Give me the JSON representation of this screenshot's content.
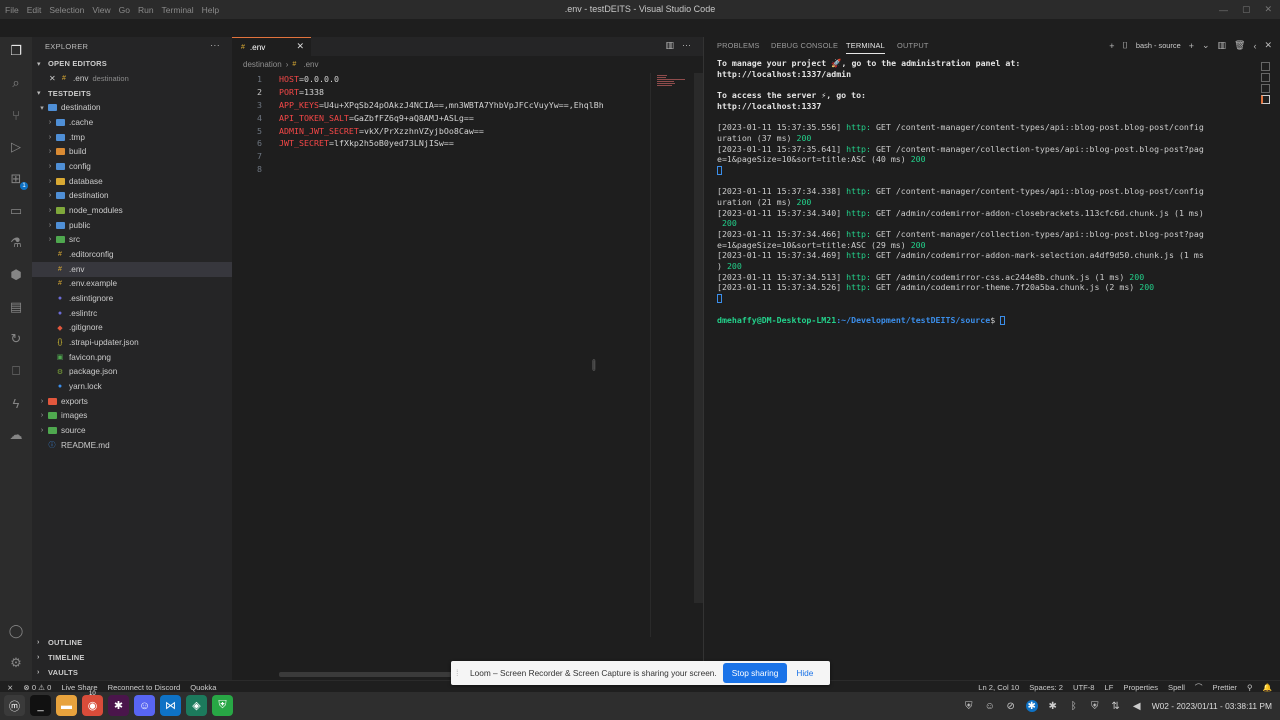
{
  "window": {
    "title": ".env - testDEITS - Visual Studio Code",
    "menu": [
      "File",
      "Edit",
      "Selection",
      "View",
      "Go",
      "Run",
      "Terminal",
      "Help"
    ]
  },
  "sidebar": {
    "header": "EXPLORER",
    "open_editors_label": "OPEN EDITORS",
    "open_editor": {
      "name": ".env",
      "folder": "destination"
    },
    "workspace_label": "TESTDEITS",
    "tree": [
      {
        "name": "destination",
        "depth": 1,
        "type": "folder",
        "open": true,
        "color": "#4f8fd6"
      },
      {
        "name": ".cache",
        "depth": 2,
        "type": "folder",
        "open": false,
        "color": "#4f8fd6"
      },
      {
        "name": ".tmp",
        "depth": 2,
        "type": "folder",
        "open": false,
        "color": "#4f8fd6"
      },
      {
        "name": "build",
        "depth": 2,
        "type": "folder",
        "open": false,
        "color": "#d98a33"
      },
      {
        "name": "config",
        "depth": 2,
        "type": "folder",
        "open": false,
        "color": "#4f8fd6"
      },
      {
        "name": "database",
        "depth": 2,
        "type": "folder",
        "open": false,
        "color": "#d9a933"
      },
      {
        "name": "destination",
        "depth": 2,
        "type": "folder",
        "open": false,
        "color": "#4f8fd6"
      },
      {
        "name": "node_modules",
        "depth": 2,
        "type": "folder",
        "open": false,
        "color": "#7fa83b"
      },
      {
        "name": "public",
        "depth": 2,
        "type": "folder",
        "open": false,
        "color": "#4f8fd6"
      },
      {
        "name": "src",
        "depth": 2,
        "type": "folder",
        "open": false,
        "color": "#4fa84f"
      },
      {
        "name": ".editorconfig",
        "depth": 2,
        "type": "file",
        "icon": "#",
        "color": "#d9a933"
      },
      {
        "name": ".env",
        "depth": 2,
        "type": "file",
        "icon": "#",
        "color": "#d9a933",
        "selected": true
      },
      {
        "name": ".env.example",
        "depth": 2,
        "type": "file",
        "icon": "#",
        "color": "#d9a933"
      },
      {
        "name": ".eslintignore",
        "depth": 2,
        "type": "file",
        "icon": "●",
        "color": "#6b6bd6"
      },
      {
        "name": ".eslintrc",
        "depth": 2,
        "type": "file",
        "icon": "●",
        "color": "#6b6bd6"
      },
      {
        "name": ".gitignore",
        "depth": 2,
        "type": "file",
        "icon": "◆",
        "color": "#e2573d"
      },
      {
        "name": ".strapi-updater.json",
        "depth": 2,
        "type": "file",
        "icon": "{}",
        "color": "#d9c433"
      },
      {
        "name": "favicon.png",
        "depth": 2,
        "type": "file",
        "icon": "▣",
        "color": "#4fa84f"
      },
      {
        "name": "package.json",
        "depth": 2,
        "type": "file",
        "icon": "⚙",
        "color": "#7fa83b"
      },
      {
        "name": "yarn.lock",
        "depth": 2,
        "type": "file",
        "icon": "●",
        "color": "#3b8eea"
      },
      {
        "name": "exports",
        "depth": 1,
        "type": "folder",
        "open": false,
        "color": "#e2573d"
      },
      {
        "name": "images",
        "depth": 1,
        "type": "folder",
        "open": false,
        "color": "#4fa84f"
      },
      {
        "name": "source",
        "depth": 1,
        "type": "folder",
        "open": false,
        "color": "#4fa84f"
      },
      {
        "name": "README.md",
        "depth": 1,
        "type": "file",
        "icon": "ⓘ",
        "color": "#3b8eea"
      }
    ],
    "outline_label": "OUTLINE",
    "timeline_label": "TIMELINE",
    "vaults_label": "VAULTS"
  },
  "editor": {
    "tab_label": ".env",
    "breadcrumb": [
      "destination",
      ".env"
    ],
    "current_line": 2,
    "lines": [
      {
        "key": "HOST",
        "value": "0.0.0.0"
      },
      {
        "key": "PORT",
        "value": "1338"
      },
      {
        "key": "APP_KEYS",
        "value": "U4u+XPqSb24pOAkzJ4NCIA==,mn3WBTA7YhbVpJFCcVuyYw==,EhqlBh"
      },
      {
        "key": "API_TOKEN_SALT",
        "value": "GaZbfFZ6q9+aQ8AMJ+ASLg=="
      },
      {
        "key": "ADMIN_JWT_SECRET",
        "value": "vkX/PrXzzhnVZyjbOo8Caw=="
      },
      {
        "key": "JWT_SECRET",
        "value": "lfXkp2h5oB0yed73LNjISw=="
      },
      {
        "key": "",
        "value": ""
      },
      {
        "key": "",
        "value": ""
      }
    ]
  },
  "panel": {
    "tabs": [
      "PROBLEMS",
      "DEBUG CONSOLE",
      "TERMINAL",
      "OUTPUT"
    ],
    "active_tab": "TERMINAL",
    "shell_label": "bash - source",
    "terminal": {
      "intro1": "To manage your project 🚀, go to the administration panel at:",
      "admin_url": "http://localhost:1337/admin",
      "intro2": "To access the server ⚡, go to:",
      "server_url": "http://localhost:1337",
      "log_groups": [
        [
          {
            "ts": "[2023-01-11 15:37:35.556]",
            "method": "GET",
            "path": "/content-manager/content-types/api::blog-post.blog-post/config",
            "cont": "uration (37 ms)",
            "status": "200"
          },
          {
            "ts": "[2023-01-11 15:37:35.641]",
            "method": "GET",
            "path": "/content-manager/collection-types/api::blog-post.blog-post?pag",
            "cont": "e=1&pageSize=10&sort=title:ASC (40 ms)",
            "status": "200"
          }
        ],
        [
          {
            "ts": "[2023-01-11 15:37:34.338]",
            "method": "GET",
            "path": "/content-manager/content-types/api::blog-post.blog-post/config",
            "cont": "uration (21 ms)",
            "status": "200"
          },
          {
            "ts": "[2023-01-11 15:37:34.340]",
            "method": "GET",
            "path": "/admin/codemirror-addon-closebrackets.113cfc6d.chunk.js (1 ms)",
            "cont": "",
            "status": "200"
          },
          {
            "ts": "[2023-01-11 15:37:34.466]",
            "method": "GET",
            "path": "/content-manager/collection-types/api::blog-post.blog-post?pag",
            "cont": "e=1&pageSize=10&sort=title:ASC (29 ms)",
            "status": "200"
          },
          {
            "ts": "[2023-01-11 15:37:34.469]",
            "method": "GET",
            "path": "/admin/codemirror-addon-mark-selection.a4df9d50.chunk.js (1 ms",
            "cont": ")",
            "status": "200"
          },
          {
            "ts": "[2023-01-11 15:37:34.513]",
            "method": "GET",
            "path": "/admin/codemirror-css.ac244e8b.chunk.js (1 ms)",
            "cont": null,
            "status": "200"
          },
          {
            "ts": "[2023-01-11 15:37:34.526]",
            "method": "GET",
            "path": "/admin/codemirror-theme.7f20a5ba.chunk.js (2 ms)",
            "cont": null,
            "status": "200"
          }
        ]
      ],
      "prompt_user": "dmehaffy@DM-Desktop-LM21",
      "prompt_path": ":~/Development/testDEITS/source",
      "prompt_end": "$"
    }
  },
  "statusbar": {
    "left": [
      "⊗ 0 ⚠ 0",
      "Live Share",
      "Reconnect to Discord",
      "Quokka"
    ],
    "right": [
      "Ln 2, Col 10",
      "Spaces: 2",
      "UTF-8",
      "LF",
      "Properties",
      "Spell",
      "Prettier"
    ]
  },
  "loom": {
    "message": "Loom – Screen Recorder & Screen Capture is sharing your screen.",
    "stop": "Stop sharing",
    "hide": "Hide"
  },
  "taskbar": {
    "clock": "W02 - 2023/01/11 - 03:38:11 PM",
    "badge": "10"
  }
}
